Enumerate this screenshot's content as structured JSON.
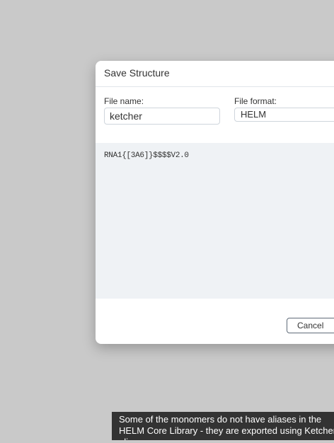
{
  "dialog": {
    "title": "Save Structure",
    "file_name_label": "File name:",
    "file_name_value": "ketcher",
    "file_format_label": "File format:",
    "file_format_value": "HELM",
    "content": "RNA1{[3A6]}$$$$V2.0",
    "cancel_label": "Cancel"
  },
  "toast": {
    "message": "Some of the monomers do not have aliases in the HELM Core Library - they are exported using Ketcher aliases."
  },
  "colors": {
    "overlay": "#c9c9c9",
    "content_background": "#eff2f5",
    "toast_background": "#333333"
  }
}
